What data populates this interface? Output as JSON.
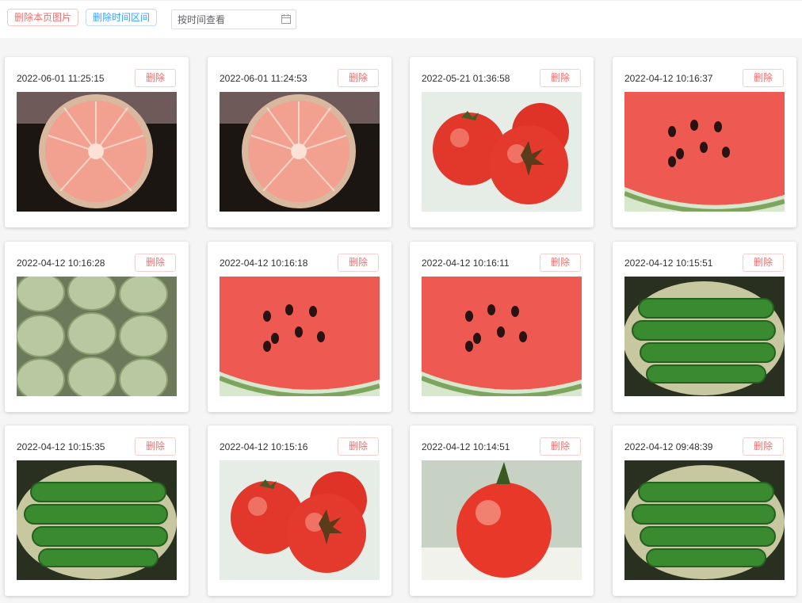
{
  "toolbar": {
    "delete_page_label": "删除本页图片",
    "delete_range_label": "删除时间区间",
    "date_placeholder": "按时间查看"
  },
  "cards": [
    {
      "timestamp": "2022-06-01 11:25:15",
      "delete_label": "删除",
      "subject": "grapefruit"
    },
    {
      "timestamp": "2022-06-01 11:24:53",
      "delete_label": "删除",
      "subject": "grapefruit"
    },
    {
      "timestamp": "2022-05-21 01:36:58",
      "delete_label": "删除",
      "subject": "tomatoes"
    },
    {
      "timestamp": "2022-04-12 10:16:37",
      "delete_label": "删除",
      "subject": "watermelon"
    },
    {
      "timestamp": "2022-04-12 10:16:28",
      "delete_label": "删除",
      "subject": "melons"
    },
    {
      "timestamp": "2022-04-12 10:16:18",
      "delete_label": "删除",
      "subject": "watermelon"
    },
    {
      "timestamp": "2022-04-12 10:16:11",
      "delete_label": "删除",
      "subject": "watermelon"
    },
    {
      "timestamp": "2022-04-12 10:15:51",
      "delete_label": "删除",
      "subject": "cucumbers"
    },
    {
      "timestamp": "2022-04-12 10:15:35",
      "delete_label": "删除",
      "subject": "cucumbers"
    },
    {
      "timestamp": "2022-04-12 10:15:16",
      "delete_label": "删除",
      "subject": "tomatoes"
    },
    {
      "timestamp": "2022-04-12 10:14:51",
      "delete_label": "删除",
      "subject": "tomato"
    },
    {
      "timestamp": "2022-04-12 09:48:39",
      "delete_label": "删除",
      "subject": "cucumbers"
    }
  ],
  "colors": {
    "danger": "#f56c6c",
    "primary": "#409eff",
    "background": "#f5f5f5"
  },
  "icons": {
    "date_input": "calendar-icon"
  }
}
